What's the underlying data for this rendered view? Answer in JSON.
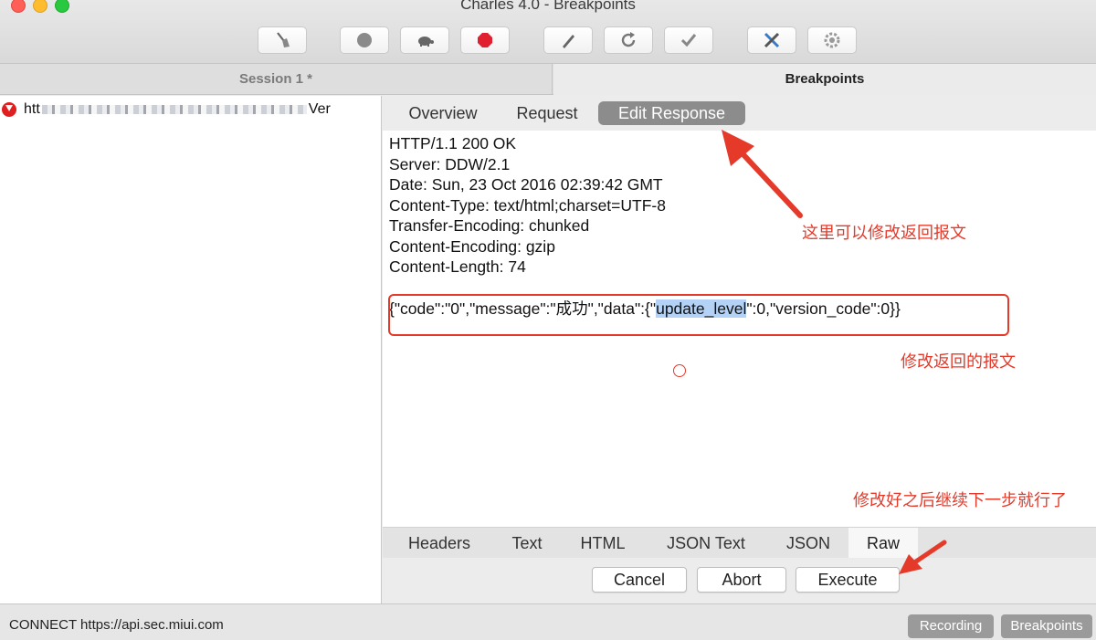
{
  "window": {
    "title": "Charles 4.0 - Breakpoints"
  },
  "toolbar": {
    "items": [
      {
        "name": "broom-icon"
      },
      {
        "name": "record-icon"
      },
      {
        "name": "turtle-icon"
      },
      {
        "name": "stop-icon"
      },
      {
        "name": "pen-icon"
      },
      {
        "name": "refresh-icon"
      },
      {
        "name": "check-icon"
      },
      {
        "name": "tools-icon"
      },
      {
        "name": "gear-icon"
      }
    ]
  },
  "tabs": {
    "session": "Session 1 *",
    "breakpoints": "Breakpoints"
  },
  "request_list": {
    "row_prefix": "htt",
    "row_suffix": "Ver"
  },
  "subtabs": {
    "overview": "Overview",
    "request": "Request",
    "edit_response": "Edit Response"
  },
  "response": {
    "headers": [
      "HTTP/1.1 200 OK",
      "Server: DDW/2.1",
      "Date: Sun, 23 Oct 2016 02:39:42 GMT",
      "Content-Type: text/html;charset=UTF-8",
      "Transfer-Encoding: chunked",
      "Content-Encoding: gzip",
      "Content-Length: 74"
    ],
    "body_before": "{\"code\":\"0\",\"message\":\"成功\",\"data\":{\"",
    "body_selected": "update_level",
    "body_after": "\":0,\"version_code\":0}}"
  },
  "view_tabs": [
    "Headers",
    "Text",
    "HTML",
    "JSON Text",
    "JSON",
    "Raw"
  ],
  "view_tabs_active": "Raw",
  "actions": {
    "cancel": "Cancel",
    "abort": "Abort",
    "execute": "Execute"
  },
  "status": {
    "text": "CONNECT https://api.sec.miui.com",
    "recording": "Recording",
    "breakpoints": "Breakpoints"
  },
  "annotations": {
    "edit_response_note": "这里可以修改返回报文",
    "body_note": "修改返回的报文",
    "execute_note": "修改好之后继续下一步就行了"
  },
  "colors": {
    "annotation": "#e53a2a",
    "selection": "#b3d2f5",
    "active_tab": "#8c8c8c"
  }
}
